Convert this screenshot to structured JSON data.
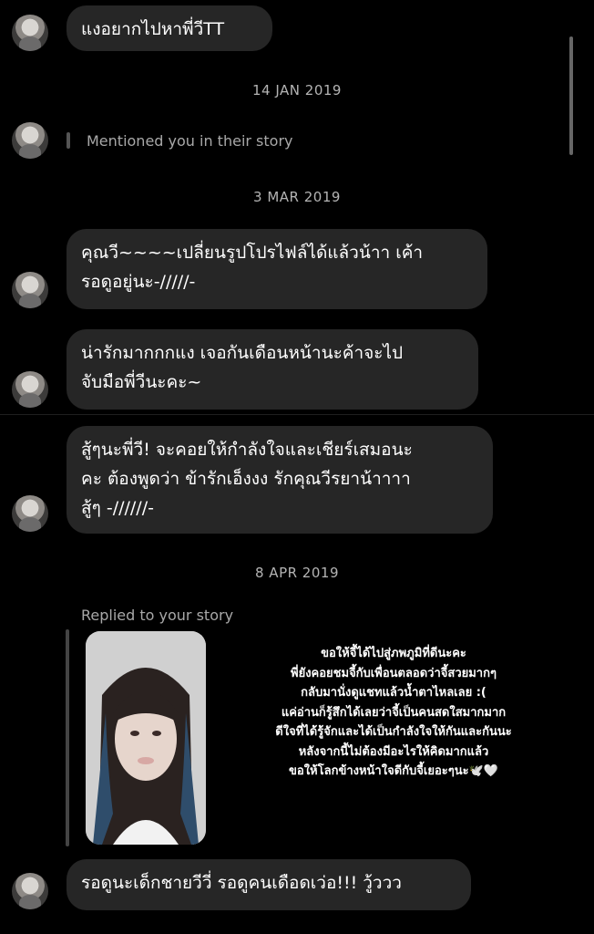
{
  "messages": [
    {
      "text": "แงอยากไปหาพี่วีTT"
    },
    {
      "text": "คุณวี~~~~เปลี่ยนรูปโปรไฟล์ได้แล้วน้าา เค้า\nรอดูอยู่นะ-/////-"
    },
    {
      "text": "น่ารักมากกกแง เจอกันเดือนหน้านะค้าจะไป\nจับมือพี่วีนะคะ~"
    },
    {
      "text": "สู้ๆนะพี่วี! จะคอยให้กำลังใจและเชียร์เสมอนะ\nคะ ต้องพูดว่า ข้ารักเอ็งงง รักคุณวีรยาน้าาาา\nสู้ๆ -//////-"
    },
    {
      "text": "รอดูนะเด็กชายวีวี่ รอดูคนเดือดเว่อ!!! วู้ววว"
    }
  ],
  "dates": [
    "14 JAN 2019",
    "3 MAR 2019",
    "8 APR 2019"
  ],
  "mention_text": "Mentioned you in their story",
  "replied_label": "Replied to your story",
  "story_caption": "ขอให้จี้ได้ไปสู่ภพภูมิที่ดีนะคะ\nพี่ยังคอยชมจี้กับเพื่อนตลอดว่าจี้สวยมากๆ\nกลับมานั่งดูแชทแล้วน้ำตาไหลเลย :(\nแค่อ่านก็รู้สึกได้เลยว่าจี้เป็นคนสดใสมากมาก\nดีใจที่ได้รู้จักและได้เป็นกำลังใจให้กันและกันนะ\nหลังจากนี้ไม่ต้องมีอะไรให้คิดมากแล้ว\nขอให้โลกข้างหน้าใจดีกับจี้เยอะๆนะ🕊️🤍",
  "colors": {
    "background": "#000000",
    "bubble": "#262626",
    "meta_text": "#b4b4b4"
  }
}
